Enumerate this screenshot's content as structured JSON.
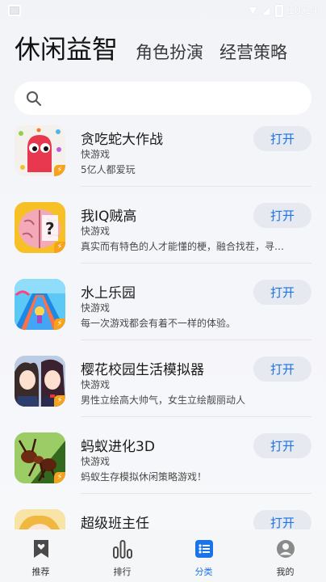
{
  "status_bar": {
    "time": "10:14"
  },
  "category_tabs": [
    {
      "label": "休闲益智",
      "active": true
    },
    {
      "label": "角色扮演",
      "active": false
    },
    {
      "label": "经营策略",
      "active": false
    }
  ],
  "search": {
    "placeholder": "",
    "icon": "search-icon"
  },
  "games": [
    {
      "name": "贪吃蛇大作战",
      "type": "快游戏",
      "desc": "5亿人都爱玩",
      "button": "打开",
      "icon": "snake-game-icon"
    },
    {
      "name": "我IQ贼高",
      "type": "快游戏",
      "desc": "真实而有特色的人才能懂的梗，融合找茬，寻…",
      "button": "打开",
      "icon": "brain-game-icon"
    },
    {
      "name": "水上乐园",
      "type": "快游戏",
      "desc": "每一次游戏都会有着不一样的体验。",
      "button": "打开",
      "icon": "water-park-game-icon"
    },
    {
      "name": "樱花校园生活模拟器",
      "type": "快游戏",
      "desc": "男性立绘高大帅气，女生立绘靓丽动人",
      "button": "打开",
      "icon": "sakura-school-game-icon"
    },
    {
      "name": "蚂蚁进化3D",
      "type": "快游戏",
      "desc": "蚂蚁生存模拟休闲策略游戏！",
      "button": "打开",
      "icon": "ant-evolution-game-icon"
    },
    {
      "name": "超级班主任",
      "type": "",
      "desc": "",
      "button": "打开",
      "icon": "super-teacher-game-icon"
    }
  ],
  "bottom_nav": [
    {
      "label": "推荐",
      "icon": "bookmark-heart-icon",
      "active": false
    },
    {
      "label": "排行",
      "icon": "ranking-bars-icon",
      "active": false
    },
    {
      "label": "分类",
      "icon": "category-list-icon",
      "active": true
    },
    {
      "label": "我的",
      "icon": "profile-icon",
      "active": false
    }
  ],
  "colors": {
    "accent": "#1a73e8",
    "button_bg": "#e6e9ef",
    "badge": "#f7a21b"
  }
}
